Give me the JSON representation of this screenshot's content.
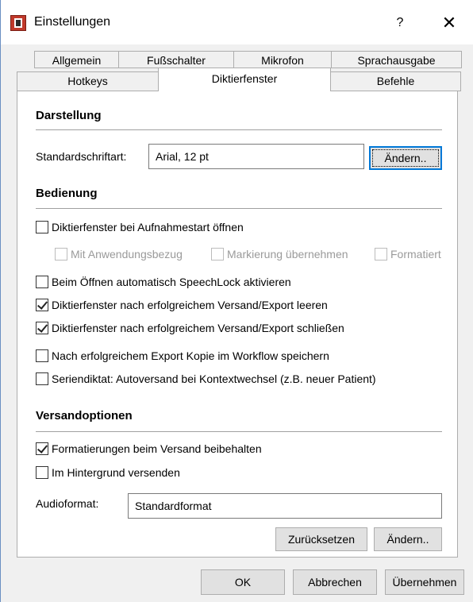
{
  "window": {
    "title": "Einstellungen",
    "help": "?",
    "close": "✕"
  },
  "tabs": {
    "row1": [
      "Allgemein",
      "Fußschalter",
      "Mikrofon",
      "Sprachausgabe"
    ],
    "row2": [
      "Hotkeys",
      "Diktierfenster",
      "Befehle"
    ],
    "active": "Diktierfenster"
  },
  "darstellung": {
    "heading": "Darstellung",
    "font_label": "Standardschriftart:",
    "font_value": "Arial, 12 pt",
    "change_button": "Ändern.."
  },
  "bedienung": {
    "heading": "Bedienung",
    "open_on_record": {
      "label": "Diktierfenster bei Aufnahmestart öffnen",
      "checked": false
    },
    "sub_options": [
      {
        "label": "Mit Anwendungsbezug",
        "checked": false,
        "disabled": true
      },
      {
        "label": "Markierung übernehmen",
        "checked": false,
        "disabled": true
      },
      {
        "label": "Formatiert",
        "checked": false,
        "disabled": true
      }
    ],
    "options": [
      {
        "label": "Beim Öffnen automatisch SpeechLock aktivieren",
        "checked": false
      },
      {
        "label": "Diktierfenster nach erfolgreichem Versand/Export leeren",
        "checked": true
      },
      {
        "label": "Diktierfenster nach erfolgreichem Versand/Export schließen",
        "checked": true
      },
      {
        "label": "Nach erfolgreichem Export Kopie im Workflow speichern",
        "checked": false
      },
      {
        "label": "Seriendiktat: Autoversand bei Kontextwechsel (z.B. neuer Patient)",
        "checked": false
      }
    ]
  },
  "versand": {
    "heading": "Versandoptionen",
    "options": [
      {
        "label": "Formatierungen beim Versand beibehalten",
        "checked": true
      },
      {
        "label": "Im Hintergrund versenden",
        "checked": false
      }
    ],
    "audio_label": "Audioformat:",
    "audio_value": "Standardformat",
    "reset_button": "Zurücksetzen",
    "change_button": "Ändern.."
  },
  "footer": {
    "ok": "OK",
    "cancel": "Abbrechen",
    "apply": "Übernehmen"
  }
}
